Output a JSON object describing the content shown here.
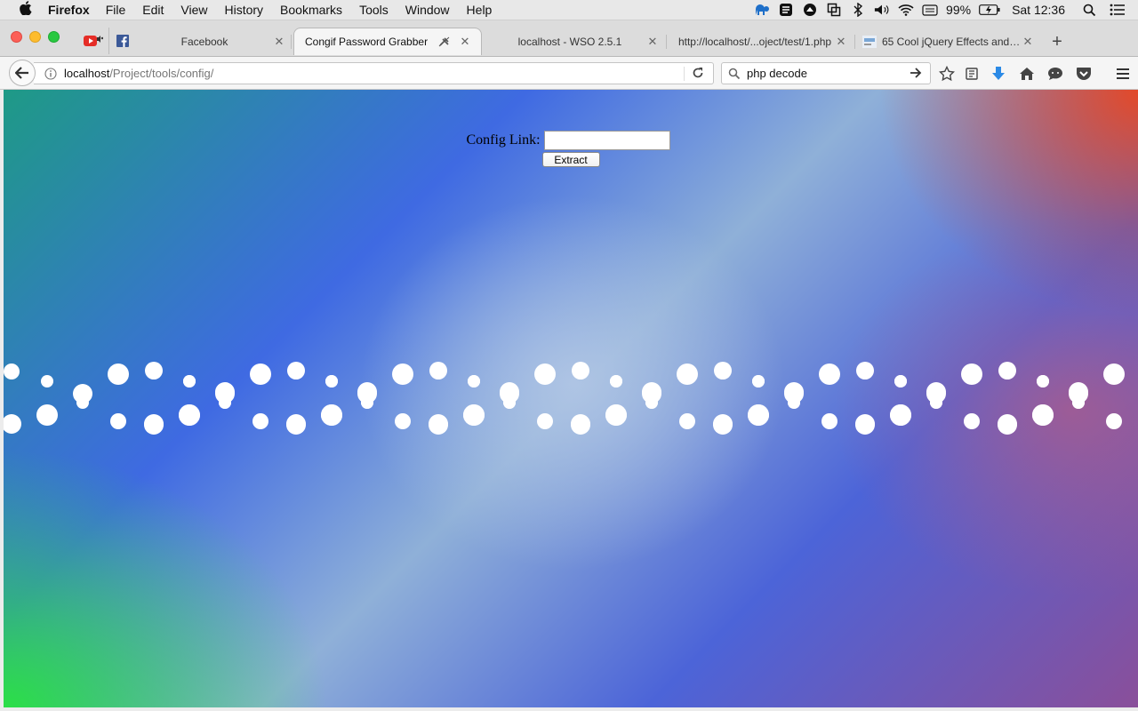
{
  "menubar": {
    "app": "Firefox",
    "items": [
      "File",
      "Edit",
      "View",
      "History",
      "Bookmarks",
      "Tools",
      "Window",
      "Help"
    ],
    "battery": "99%",
    "clock": "Sat 12:36"
  },
  "tabs": [
    {
      "label": "Facebook",
      "icon": "facebook-icon",
      "active": false
    },
    {
      "label": "Congif Password Grabber",
      "icon": "",
      "active": true
    },
    {
      "label": "localhost - WSO 2.5.1",
      "icon": "",
      "active": false
    },
    {
      "label": "http://localhost/...oject/test/1.php",
      "icon": "",
      "active": false
    },
    {
      "label": "65 Cool jQuery Effects and ...",
      "icon": "site-thumbnail-icon",
      "active": false
    }
  ],
  "navbar": {
    "url_host": "localhost",
    "url_path": "/Project/tools/config/",
    "search_value": "php decode"
  },
  "page": {
    "config_label": "Config Link:",
    "config_value": "",
    "extract_label": "Extract"
  },
  "colors": {
    "gradient_green": "#1ee63c",
    "gradient_blue": "#3f6ae2",
    "gradient_orange": "#eb461e",
    "gradient_purple": "#8a4f9a"
  }
}
